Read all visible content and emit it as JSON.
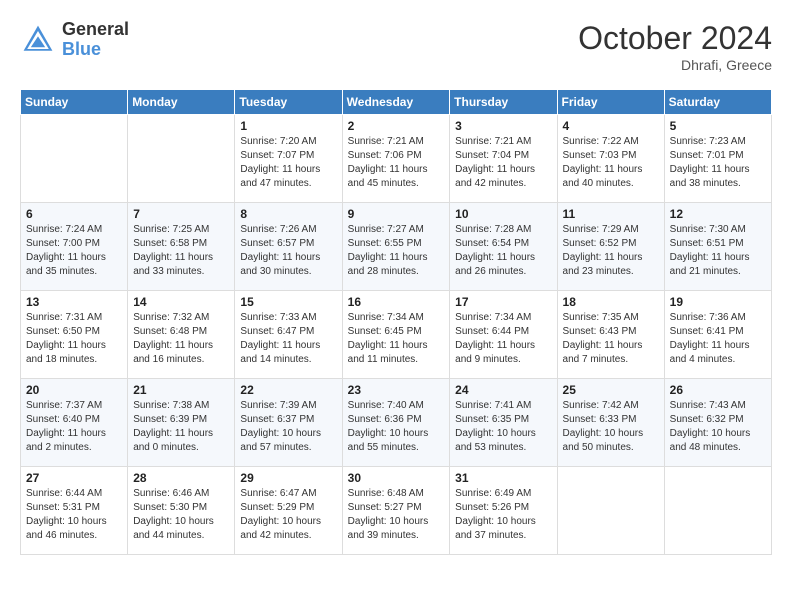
{
  "header": {
    "logo_general": "General",
    "logo_blue": "Blue",
    "month_title": "October 2024",
    "location": "Dhrafi, Greece"
  },
  "days_of_week": [
    "Sunday",
    "Monday",
    "Tuesday",
    "Wednesday",
    "Thursday",
    "Friday",
    "Saturday"
  ],
  "weeks": [
    [
      {
        "day": "",
        "info": ""
      },
      {
        "day": "",
        "info": ""
      },
      {
        "day": "1",
        "info": "Sunrise: 7:20 AM\nSunset: 7:07 PM\nDaylight: 11 hours and 47 minutes."
      },
      {
        "day": "2",
        "info": "Sunrise: 7:21 AM\nSunset: 7:06 PM\nDaylight: 11 hours and 45 minutes."
      },
      {
        "day": "3",
        "info": "Sunrise: 7:21 AM\nSunset: 7:04 PM\nDaylight: 11 hours and 42 minutes."
      },
      {
        "day": "4",
        "info": "Sunrise: 7:22 AM\nSunset: 7:03 PM\nDaylight: 11 hours and 40 minutes."
      },
      {
        "day": "5",
        "info": "Sunrise: 7:23 AM\nSunset: 7:01 PM\nDaylight: 11 hours and 38 minutes."
      }
    ],
    [
      {
        "day": "6",
        "info": "Sunrise: 7:24 AM\nSunset: 7:00 PM\nDaylight: 11 hours and 35 minutes."
      },
      {
        "day": "7",
        "info": "Sunrise: 7:25 AM\nSunset: 6:58 PM\nDaylight: 11 hours and 33 minutes."
      },
      {
        "day": "8",
        "info": "Sunrise: 7:26 AM\nSunset: 6:57 PM\nDaylight: 11 hours and 30 minutes."
      },
      {
        "day": "9",
        "info": "Sunrise: 7:27 AM\nSunset: 6:55 PM\nDaylight: 11 hours and 28 minutes."
      },
      {
        "day": "10",
        "info": "Sunrise: 7:28 AM\nSunset: 6:54 PM\nDaylight: 11 hours and 26 minutes."
      },
      {
        "day": "11",
        "info": "Sunrise: 7:29 AM\nSunset: 6:52 PM\nDaylight: 11 hours and 23 minutes."
      },
      {
        "day": "12",
        "info": "Sunrise: 7:30 AM\nSunset: 6:51 PM\nDaylight: 11 hours and 21 minutes."
      }
    ],
    [
      {
        "day": "13",
        "info": "Sunrise: 7:31 AM\nSunset: 6:50 PM\nDaylight: 11 hours and 18 minutes."
      },
      {
        "day": "14",
        "info": "Sunrise: 7:32 AM\nSunset: 6:48 PM\nDaylight: 11 hours and 16 minutes."
      },
      {
        "day": "15",
        "info": "Sunrise: 7:33 AM\nSunset: 6:47 PM\nDaylight: 11 hours and 14 minutes."
      },
      {
        "day": "16",
        "info": "Sunrise: 7:34 AM\nSunset: 6:45 PM\nDaylight: 11 hours and 11 minutes."
      },
      {
        "day": "17",
        "info": "Sunrise: 7:34 AM\nSunset: 6:44 PM\nDaylight: 11 hours and 9 minutes."
      },
      {
        "day": "18",
        "info": "Sunrise: 7:35 AM\nSunset: 6:43 PM\nDaylight: 11 hours and 7 minutes."
      },
      {
        "day": "19",
        "info": "Sunrise: 7:36 AM\nSunset: 6:41 PM\nDaylight: 11 hours and 4 minutes."
      }
    ],
    [
      {
        "day": "20",
        "info": "Sunrise: 7:37 AM\nSunset: 6:40 PM\nDaylight: 11 hours and 2 minutes."
      },
      {
        "day": "21",
        "info": "Sunrise: 7:38 AM\nSunset: 6:39 PM\nDaylight: 11 hours and 0 minutes."
      },
      {
        "day": "22",
        "info": "Sunrise: 7:39 AM\nSunset: 6:37 PM\nDaylight: 10 hours and 57 minutes."
      },
      {
        "day": "23",
        "info": "Sunrise: 7:40 AM\nSunset: 6:36 PM\nDaylight: 10 hours and 55 minutes."
      },
      {
        "day": "24",
        "info": "Sunrise: 7:41 AM\nSunset: 6:35 PM\nDaylight: 10 hours and 53 minutes."
      },
      {
        "day": "25",
        "info": "Sunrise: 7:42 AM\nSunset: 6:33 PM\nDaylight: 10 hours and 50 minutes."
      },
      {
        "day": "26",
        "info": "Sunrise: 7:43 AM\nSunset: 6:32 PM\nDaylight: 10 hours and 48 minutes."
      }
    ],
    [
      {
        "day": "27",
        "info": "Sunrise: 6:44 AM\nSunset: 5:31 PM\nDaylight: 10 hours and 46 minutes."
      },
      {
        "day": "28",
        "info": "Sunrise: 6:46 AM\nSunset: 5:30 PM\nDaylight: 10 hours and 44 minutes."
      },
      {
        "day": "29",
        "info": "Sunrise: 6:47 AM\nSunset: 5:29 PM\nDaylight: 10 hours and 42 minutes."
      },
      {
        "day": "30",
        "info": "Sunrise: 6:48 AM\nSunset: 5:27 PM\nDaylight: 10 hours and 39 minutes."
      },
      {
        "day": "31",
        "info": "Sunrise: 6:49 AM\nSunset: 5:26 PM\nDaylight: 10 hours and 37 minutes."
      },
      {
        "day": "",
        "info": ""
      },
      {
        "day": "",
        "info": ""
      }
    ]
  ]
}
